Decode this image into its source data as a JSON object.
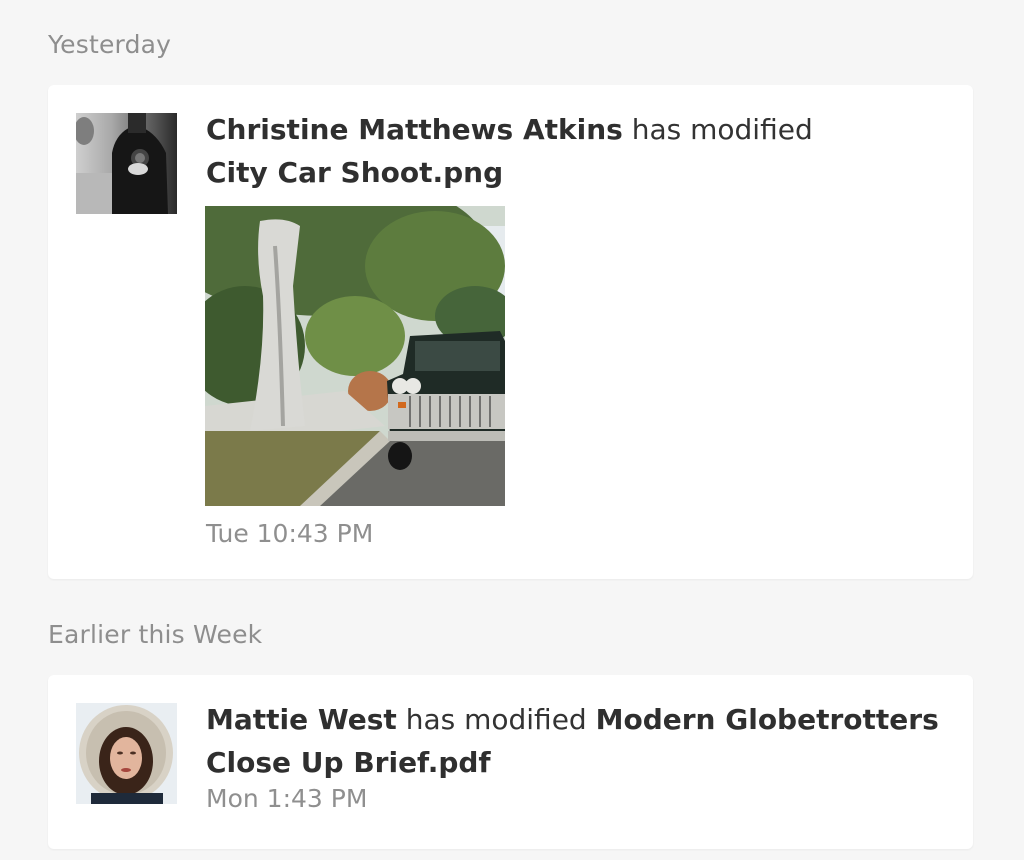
{
  "feed": {
    "sections": [
      {
        "label": "Yesterday",
        "entries": [
          {
            "user": "Christine Matthews Atkins",
            "action": "has modified",
            "file": "City Car Shoot.png",
            "time": "Tue 10:43 PM"
          }
        ]
      },
      {
        "label": "Earlier this Week",
        "entries": [
          {
            "user": "Mattie West",
            "action": "has modified",
            "file": "Modern Globetrotters Close Up Brief.pdf",
            "time": "Mon 1:43 PM"
          }
        ]
      }
    ]
  },
  "colors": {
    "background": "#f6f6f6",
    "card": "#ffffff",
    "section_header": "#8e8e8e",
    "timestamp": "#8f8f8f"
  }
}
